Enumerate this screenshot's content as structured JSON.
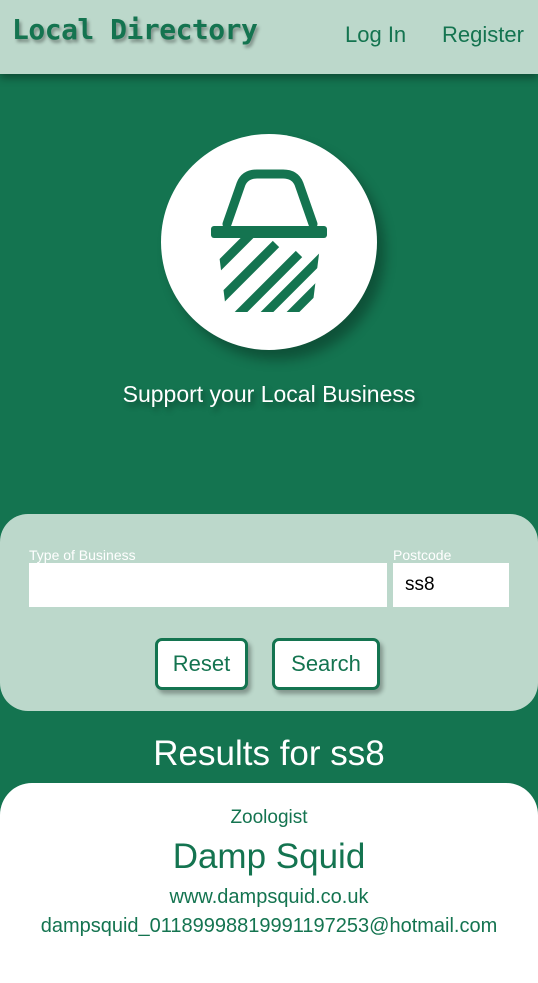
{
  "header": {
    "brand": "Local Directory",
    "nav": {
      "login": "Log In",
      "register": "Register"
    }
  },
  "hero": {
    "icon": "basket-icon",
    "tagline": "Support your Local Business"
  },
  "search": {
    "business_label": "Type of Business",
    "business_value": "",
    "postcode_label": "Postcode",
    "postcode_value": "ss8",
    "reset_label": "Reset",
    "search_label": "Search"
  },
  "results": {
    "heading": "Results for ss8",
    "items": [
      {
        "category": "Zoologist",
        "name": "Damp Squid",
        "website": "www.dampsquid.co.uk",
        "email": "dampsquid_01189998819991197253@hotmail.com"
      }
    ]
  },
  "colors": {
    "primary_green": "#147450",
    "light_green": "#bcd8cb",
    "white": "#ffffff"
  }
}
